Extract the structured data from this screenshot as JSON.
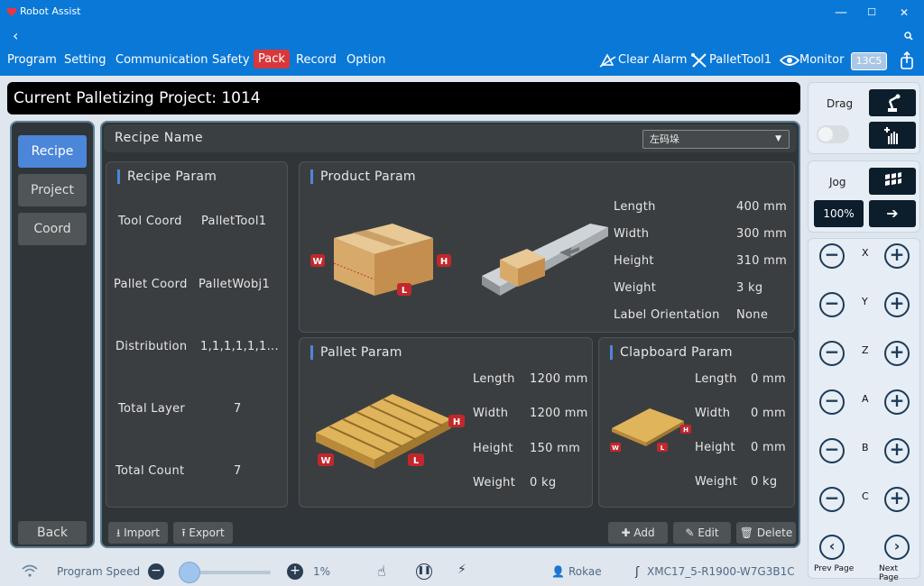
{
  "window": {
    "title": "Robot Assist",
    "minimize": "—",
    "maximize": "☐",
    "close": "✕"
  },
  "nav": {
    "back": "‹",
    "menu": [
      "Program",
      "Setting",
      "Communication",
      "Safety",
      "Pack",
      "Record",
      "Option"
    ],
    "active": "Pack",
    "tools": {
      "clear_alarm": "Clear Alarm",
      "pallet_tool": "PalletTool1",
      "monitor": "Monitor",
      "badge": "13C5"
    }
  },
  "project_bar": "Current Palletizing Project: 1014",
  "left_nav": {
    "items": [
      "Recipe",
      "Project",
      "Coord"
    ],
    "active": "Recipe",
    "back": "Back"
  },
  "recipe": {
    "name_label": "Recipe Name",
    "selected": "左码垛"
  },
  "recipe_param": {
    "title": "Recipe Param",
    "rows": [
      {
        "label": "Tool Coord",
        "value": "PalletTool1"
      },
      {
        "label": "Pallet Coord",
        "value": "PalletWobj1"
      },
      {
        "label": "Distribution",
        "value": "1,1,1,1,1,1..."
      },
      {
        "label": "Total Layer",
        "value": "7"
      },
      {
        "label": "Total Count",
        "value": "7"
      }
    ]
  },
  "product_param": {
    "title": "Product Param",
    "rows": [
      {
        "label": "Length",
        "value": "400 mm"
      },
      {
        "label": "Width",
        "value": "300 mm"
      },
      {
        "label": "Height",
        "value": "310 mm"
      },
      {
        "label": "Weight",
        "value": "3 kg"
      },
      {
        "label": "Label Orientation",
        "value": "None"
      }
    ],
    "dims": {
      "w": "W",
      "h": "H",
      "l": "L"
    }
  },
  "pallet_param": {
    "title": "Pallet Param",
    "rows": [
      {
        "label": "Length",
        "value": "1200 mm"
      },
      {
        "label": "Width",
        "value": "1200 mm"
      },
      {
        "label": "Height",
        "value": "150 mm"
      },
      {
        "label": "Weight",
        "value": "0 kg"
      }
    ]
  },
  "clapboard_param": {
    "title": "Clapboard Param",
    "rows": [
      {
        "label": "Length",
        "value": "0 mm"
      },
      {
        "label": "Width",
        "value": "0 mm"
      },
      {
        "label": "Height",
        "value": "0 mm"
      },
      {
        "label": "Weight",
        "value": "0 kg"
      }
    ]
  },
  "toolbar": {
    "import": "Import",
    "export": "Export",
    "add": "Add",
    "edit": "Edit",
    "delete": "Delete"
  },
  "right_panel": {
    "drag": "Drag",
    "jog": "Jog",
    "speed": "100%",
    "axes": [
      "X",
      "Y",
      "Z",
      "A",
      "B",
      "C"
    ],
    "prev_page": "Prev Page",
    "next_page": "Next Page"
  },
  "status": {
    "program_speed_label": "Program Speed",
    "speed_value": "1%",
    "speed_fraction": 0.1,
    "user": "Rokae",
    "controller": "XMC17_5-R1900-W7G3B1C"
  },
  "colors": {
    "accent": "#0a78d7",
    "active_tab": "#d8383a",
    "selected_nav": "#4c86d8",
    "panel": "#3b3e41",
    "dim_tag": "#c0282c"
  }
}
